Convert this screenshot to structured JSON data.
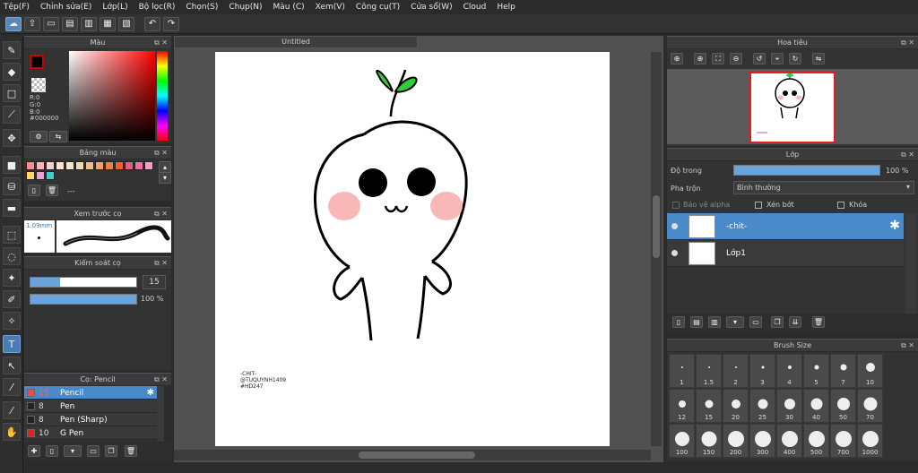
{
  "menu": [
    "Tệp(F)",
    "Chỉnh sửa(E)",
    "Lớp(L)",
    "Bộ lọc(R)",
    "Chọn(S)",
    "Chụp(N)",
    "Màu (C)",
    "Xem(V)",
    "Công cụ(T)",
    "Cửa sổ(W)",
    "Cloud",
    "Help"
  ],
  "color_panel": {
    "title": "Màu",
    "r": "R:0",
    "g": "G:0",
    "b": "B:0",
    "hex": "#000000"
  },
  "palette_panel": {
    "title": "Bảng màu",
    "name": "---"
  },
  "palette_colors": [
    "#ff8a8a",
    "#ffb3b3",
    "#f8d0d0",
    "#fde0d0",
    "#f5e6c8",
    "#f0d8b0",
    "#e8c090",
    "#f4a070",
    "#f08040",
    "#f06030",
    "#e06080",
    "#f070a0",
    "#f0a0c0",
    "#ffd86a",
    "#f0a0d0",
    "#40d0d0"
  ],
  "preview_panel": {
    "title": "Xem trước cọ",
    "size": "1.09mm"
  },
  "brush_control": {
    "title": "Kiểm soát cọ",
    "size": "15",
    "opacity": "100 %",
    "size_fill": 0.28,
    "opacity_fill": 1.0
  },
  "brush_list": {
    "title": "Cọ: Pencil",
    "items": [
      {
        "size": "15",
        "name": "Pencil",
        "color": "#ff4444",
        "selected": true
      },
      {
        "size": "8",
        "name": "Pen",
        "color": "#222222",
        "selected": false
      },
      {
        "size": "8",
        "name": "Pen (Sharp)",
        "color": "#222222",
        "selected": false
      },
      {
        "size": "10",
        "name": "G Pen",
        "color": "#e02020",
        "selected": false
      }
    ]
  },
  "document": {
    "tab": "Untitled",
    "caption": [
      "-CHIT-",
      "@TUQUYNH1409",
      "#HD247"
    ]
  },
  "navigator": {
    "title": "Hoa tiêu"
  },
  "layers": {
    "title": "Lớp",
    "opacity_label": "Độ trong",
    "opacity_value": "100 %",
    "opacity_fill": 1.0,
    "blend_label": "Pha trộn",
    "blend_value": "Bình thường",
    "protect_alpha": "Bảo vệ alpha",
    "clipping": "Xén bớt",
    "lock": "Khóa",
    "items": [
      {
        "name": "-chit-",
        "selected": true
      },
      {
        "name": "Lớp1",
        "selected": false
      }
    ]
  },
  "brush_size": {
    "title": "Brush Size",
    "sizes": [
      "1",
      "1.5",
      "2",
      "3",
      "4",
      "5",
      "7",
      "10",
      "12",
      "15",
      "20",
      "25",
      "30",
      "40",
      "50",
      "70",
      "100",
      "150",
      "200",
      "300",
      "400",
      "500",
      "700",
      "1000"
    ]
  },
  "colors": {
    "accent": "#4f8ed0",
    "selected_row": "#4a8acb",
    "sprout": "#2fcf3a"
  }
}
